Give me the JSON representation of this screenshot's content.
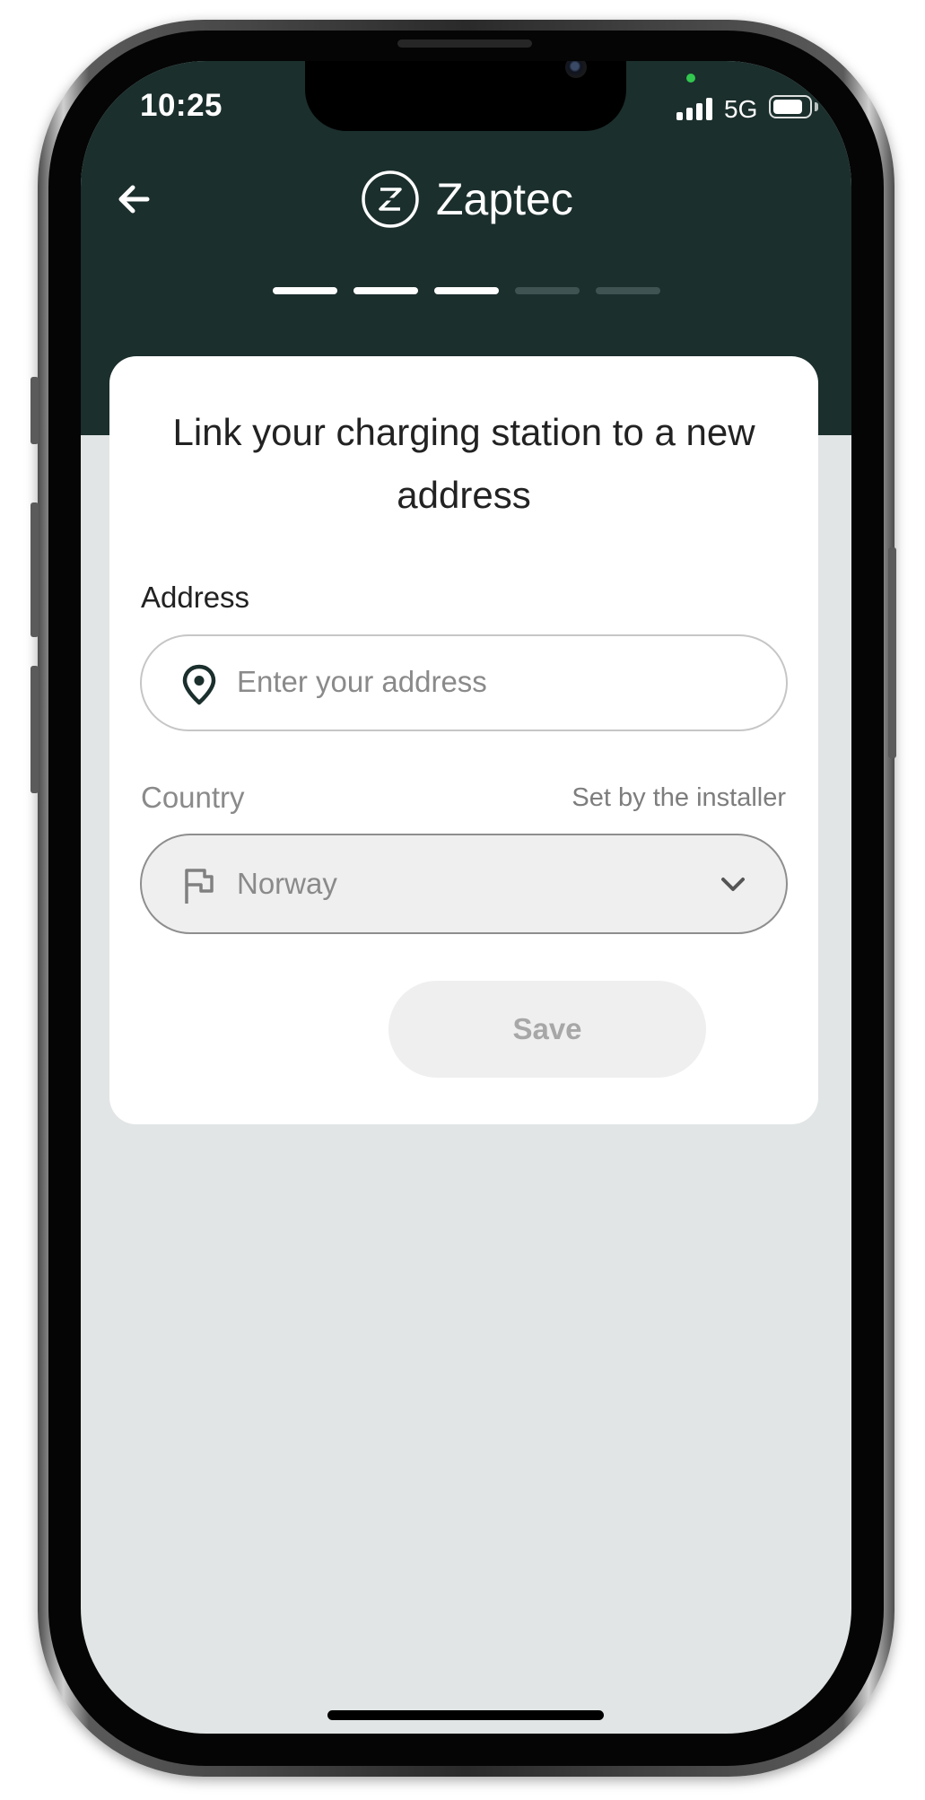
{
  "status_bar": {
    "time": "10:25",
    "network": "5G",
    "battery_level": 0.85
  },
  "header": {
    "back_icon": "arrow-left-icon",
    "app_name": "Zaptec",
    "progress": {
      "total_steps": 5,
      "completed_steps": 3
    }
  },
  "colors": {
    "header_bg": "#1b2f2d",
    "page_bg": "#e1e5e5",
    "progress_done": "#ffffff",
    "progress_pending": "#3f5452",
    "icon_dark": "#1b2f2d"
  },
  "form": {
    "title": "Link your charging station to a new address",
    "address": {
      "label": "Address",
      "placeholder": "Enter your address",
      "value": "",
      "icon": "location-pin-icon"
    },
    "country": {
      "label": "Country",
      "note": "Set by the installer",
      "value": "Norway",
      "icon": "flag-icon",
      "dropdown_icon": "chevron-down-icon",
      "disabled": true
    },
    "save_label": "Save",
    "save_disabled": true
  }
}
